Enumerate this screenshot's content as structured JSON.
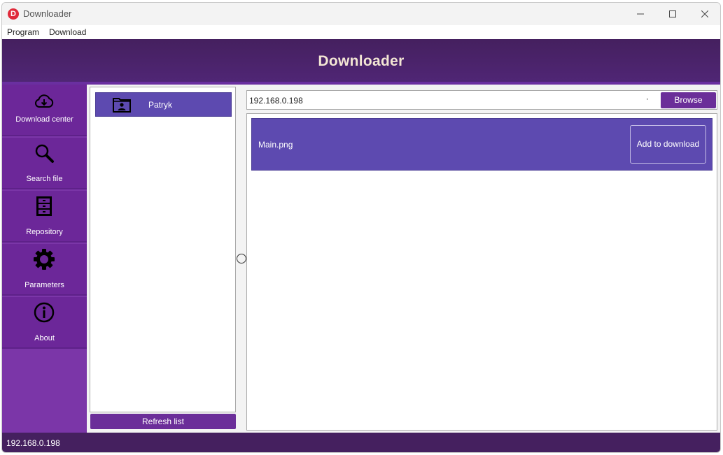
{
  "window": {
    "app_icon_letter": "D",
    "title": "Downloader"
  },
  "menu": {
    "items": [
      "Program",
      "Download"
    ]
  },
  "header": {
    "title": "Downloader"
  },
  "sidebar": {
    "items": [
      {
        "label": "Download center",
        "icon": "cloud-download-icon"
      },
      {
        "label": "Search file",
        "icon": "magnifier-icon"
      },
      {
        "label": "Repository",
        "icon": "cabinet-icon"
      },
      {
        "label": "Parameters",
        "icon": "gear-icon"
      },
      {
        "label": "About",
        "icon": "info-icon"
      }
    ]
  },
  "users": {
    "items": [
      {
        "label": "Patryk",
        "icon": "user-folder-icon"
      }
    ],
    "refresh_label": "Refresh list"
  },
  "address": {
    "value": "192.168.0.198",
    "dot": "·",
    "browse_label": "Browse"
  },
  "files": {
    "items": [
      {
        "name": "Main.png",
        "action_label": "Add to download"
      }
    ]
  },
  "status": {
    "text": "192.168.0.198"
  },
  "colors": {
    "header": "#45205f",
    "sidebar": "#6c2799",
    "accent": "#6b2e99",
    "item": "#5d4ab0"
  }
}
